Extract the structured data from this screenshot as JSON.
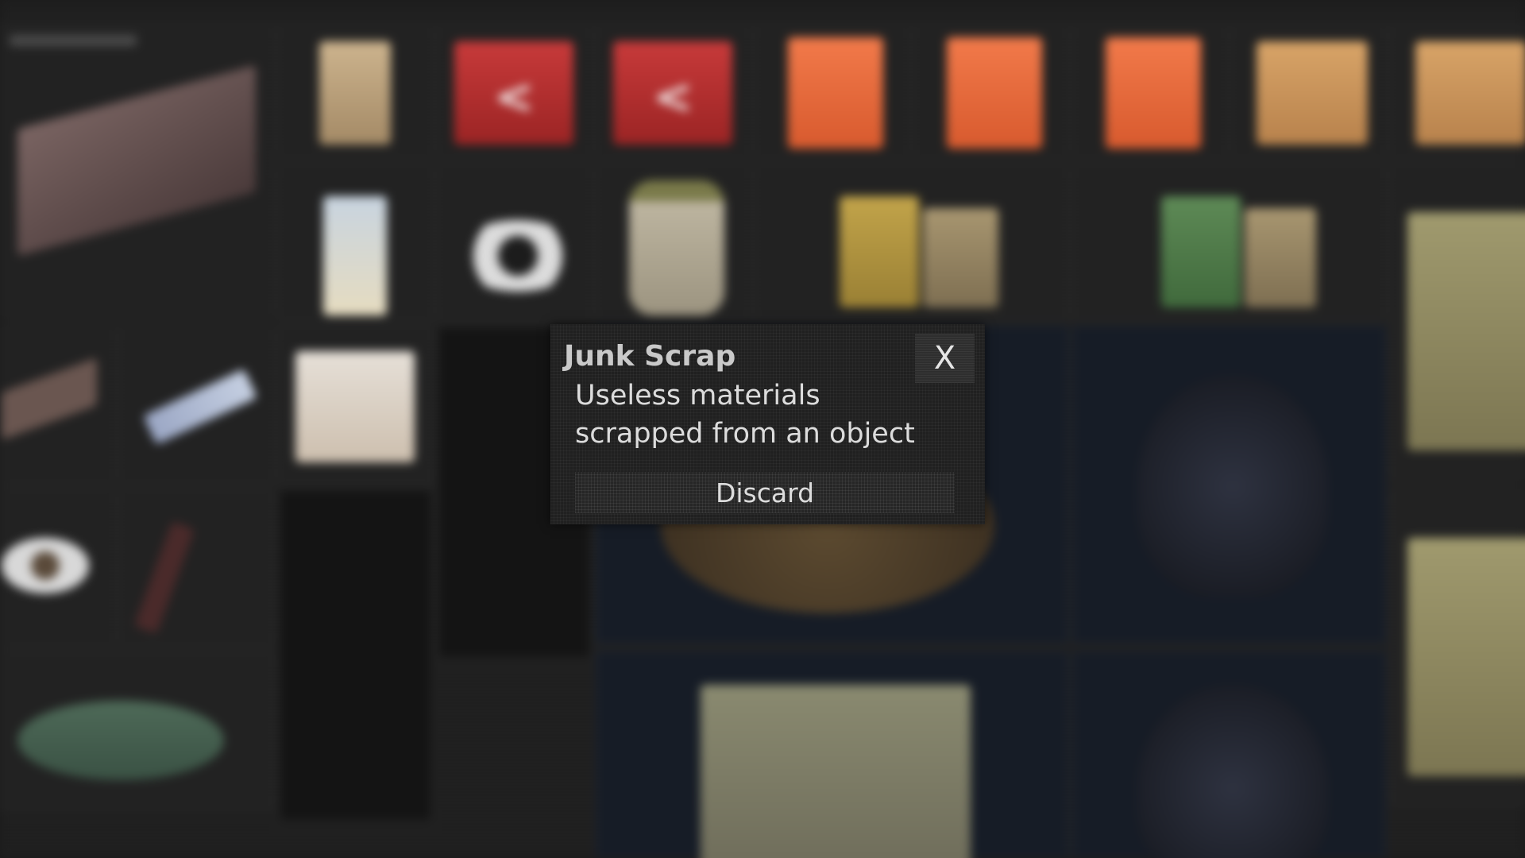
{
  "popup": {
    "title": "Junk Scrap",
    "description_line1": "Useless materials",
    "description_line2": "scrapped from an object",
    "discard_label": "Discard",
    "close_label": "X"
  },
  "inventory": {
    "chevron_glyph": "<"
  },
  "colors": {
    "popup_background": "#202020",
    "title_text": "#c9c9c9",
    "body_text": "#dcdcdc",
    "close_button_bg": "#2e2e2e"
  }
}
